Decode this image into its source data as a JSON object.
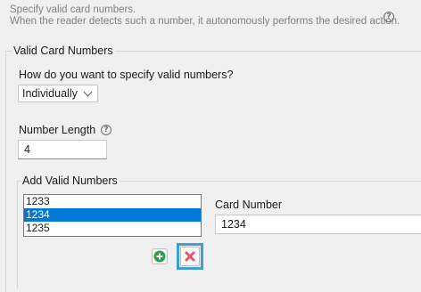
{
  "intro": {
    "line1": "Specify valid card numbers.",
    "line2": "When the reader detects such a number, it autonomously performs the desired action."
  },
  "group": {
    "title": "Valid Card Numbers",
    "specify_question": "How do you want to specify valid numbers?",
    "specify_selected": "Individually",
    "number_length_label": "Number Length",
    "number_length_value": "4"
  },
  "add_numbers": {
    "title": "Add Valid Numbers",
    "items": [
      "1233",
      "1234",
      "1235"
    ],
    "selected_index": 1,
    "card_number_label": "Card Number",
    "card_number_value": "1234"
  },
  "colors": {
    "selection": "#0078d7",
    "highlight_border": "#3ba0d8",
    "add_icon": "#2e9e4f",
    "remove_icon": "#e8556b"
  },
  "icons": [
    "help-icon",
    "chevron-down-icon",
    "plus-circle-icon",
    "x-icon"
  ]
}
